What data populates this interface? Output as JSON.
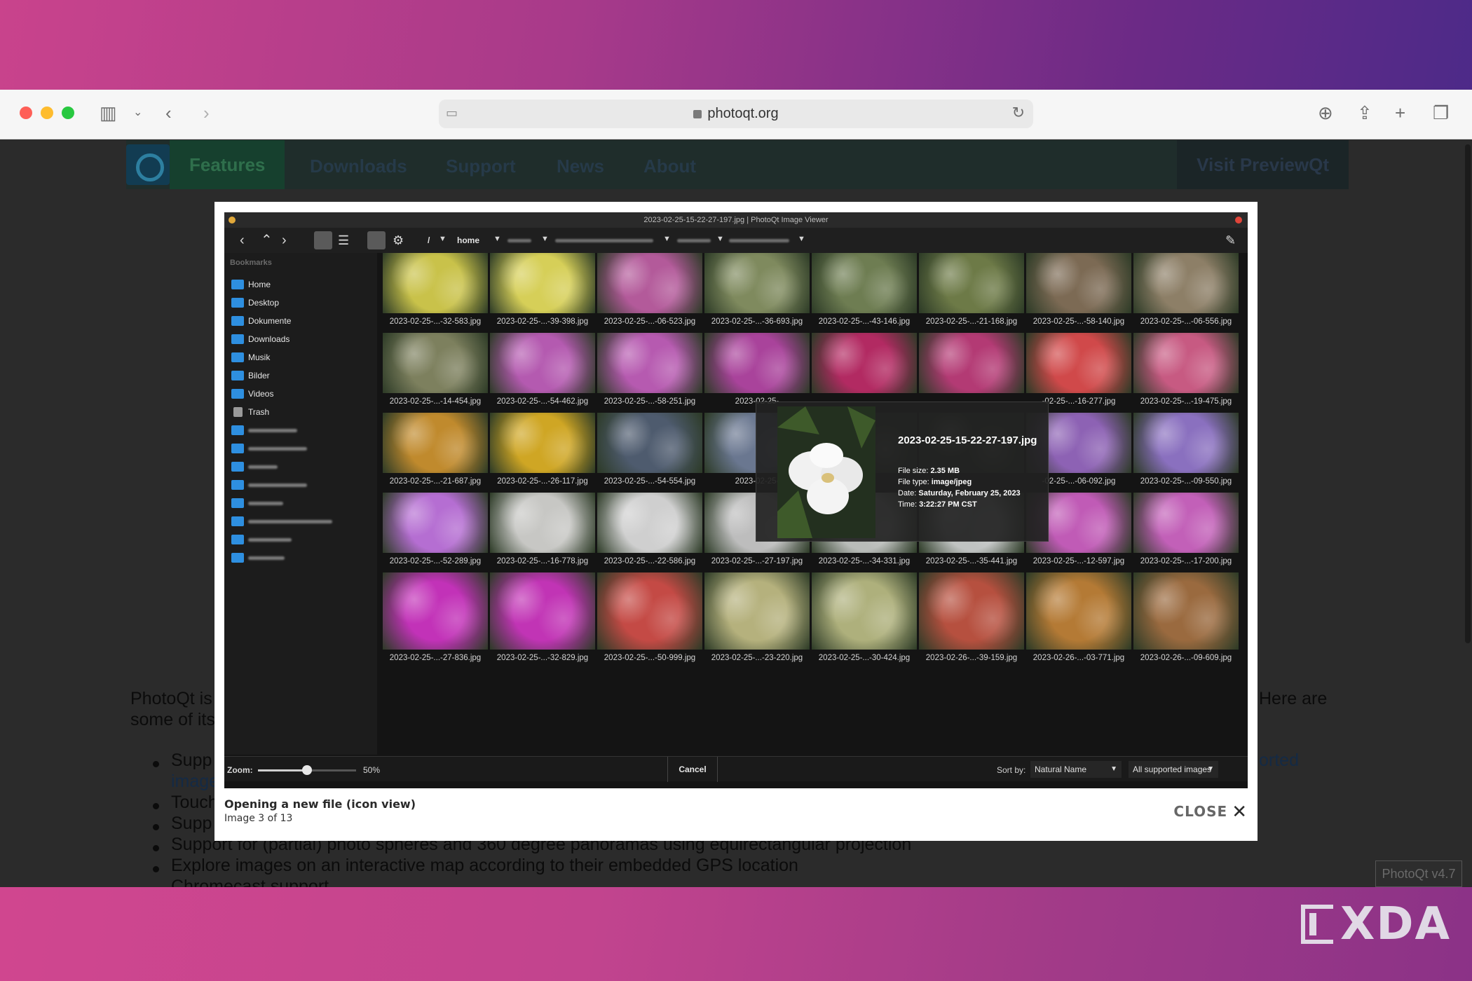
{
  "browser": {
    "url": "photoqt.org"
  },
  "site_nav": {
    "items": [
      "Features",
      "Downloads",
      "Support",
      "News",
      "About"
    ],
    "active": "Features",
    "cta": "Visit PreviewQt"
  },
  "page_text": {
    "intro_left_1": "PhotoQt is",
    "intro_right_1": "Here are",
    "intro_left_2": "some of its",
    "bullet_1_left": "Supp",
    "bullet_1_right": "orted",
    "bullet_1_line2": "image",
    "bullet_2": "Touch",
    "bullet_3": "Supp",
    "bullet_4": "Support for (partial) photo spheres and 360 degree panoramas using equirectangular projection",
    "bullet_5": "Explore images on an interactive map according to their embedded GPS location",
    "bullet_6": "Chromecast support",
    "version": "PhotoQt v4.7"
  },
  "app": {
    "title": "2023-02-25-15-22-27-197.jpg | PhotoQt Image Viewer",
    "path_root": "/",
    "path_home": "home",
    "sidebar_heading": "Bookmarks",
    "bookmarks": [
      "Home",
      "Desktop",
      "Dokumente",
      "Downloads",
      "Musik",
      "Bilder",
      "Videos",
      "Trash"
    ],
    "thumbnails": [
      "2023-02-25-...-32-583.jpg",
      "2023-02-25-...-39-398.jpg",
      "2023-02-25-...-06-523.jpg",
      "2023-02-25-...-36-693.jpg",
      "2023-02-25-...-43-146.jpg",
      "2023-02-25-...-21-168.jpg",
      "2023-02-25-...-58-140.jpg",
      "2023-02-25-...-06-556.jpg",
      "2023-02-25-...-14-454.jpg",
      "2023-02-25-...-54-462.jpg",
      "2023-02-25-...-58-251.jpg",
      "2023-02-25-",
      "",
      "",
      "-02-25-...-16-277.jpg",
      "2023-02-25-...-19-475.jpg",
      "2023-02-25-...-21-687.jpg",
      "2023-02-25-...-26-117.jpg",
      "2023-02-25-...-54-554.jpg",
      "2023-02-25-",
      "",
      "",
      "-02-25-...-06-092.jpg",
      "2023-02-25-...-09-550.jpg",
      "2023-02-25-...-52-289.jpg",
      "2023-02-25-...-16-778.jpg",
      "2023-02-25-...-22-586.jpg",
      "2023-02-25-...-27-197.jpg",
      "2023-02-25-...-34-331.jpg",
      "2023-02-25-...-35-441.jpg",
      "2023-02-25-...-12-597.jpg",
      "2023-02-25-...-17-200.jpg",
      "2023-02-25-...-27-836.jpg",
      "2023-02-25-...-32-829.jpg",
      "2023-02-25-...-50-999.jpg",
      "2023-02-25-...-23-220.jpg",
      "2023-02-25-...-30-424.jpg",
      "2023-02-26-...-39-159.jpg",
      "2023-02-26-...-03-771.jpg",
      "2023-02-26-...-09-609.jpg"
    ],
    "thumb_colors": [
      "#c9c24a",
      "#d6cf58",
      "#b35a9a",
      "#7f8a5e",
      "#6e7d52",
      "#6d7a47",
      "#7c6a54",
      "#8d7f67",
      "#7d805e",
      "#b45ab0",
      "#b65ab0",
      "#a9439b",
      "#b22a62",
      "#b33a74",
      "#d0494a",
      "#c75a82",
      "#c08a2d",
      "#cfa624",
      "#4e5b6e",
      "#6a7790",
      "#2e3a2a",
      "#2e3a2a",
      "#8d62b4",
      "#8a70bf",
      "#b56ed2",
      "#c7c7c4",
      "#cfcfcf",
      "#bdbdbd",
      "#b9bcb9",
      "#c0c3c2",
      "#c05bb6",
      "#c260b8",
      "#c232b8",
      "#c134b5",
      "#c44a45",
      "#b5b17d",
      "#aeb07c",
      "#b6503f",
      "#b47a35",
      "#9a6a3f"
    ],
    "tooltip": {
      "filename": "2023-02-25-15-22-27-197.jpg",
      "size_label": "File size:",
      "size": "2.35 MB",
      "type_label": "File type:",
      "type": "image/jpeg",
      "date_label": "Date:",
      "date": "Saturday, February 25, 2023",
      "time_label": "Time:",
      "time": "3:22:27 PM CST"
    },
    "statusbar": {
      "zoom_label": "Zoom:",
      "zoom_value": "50%",
      "zoom_fraction": 0.5,
      "cancel": "Cancel",
      "sort_label": "Sort by:",
      "sort_value": "Natural Name",
      "filter_value": "All supported images"
    }
  },
  "lightbox": {
    "caption": "Opening a new file (icon view)",
    "counter": "Image 3 of 13",
    "close_label": "CLOSE"
  },
  "watermark": "XDA"
}
